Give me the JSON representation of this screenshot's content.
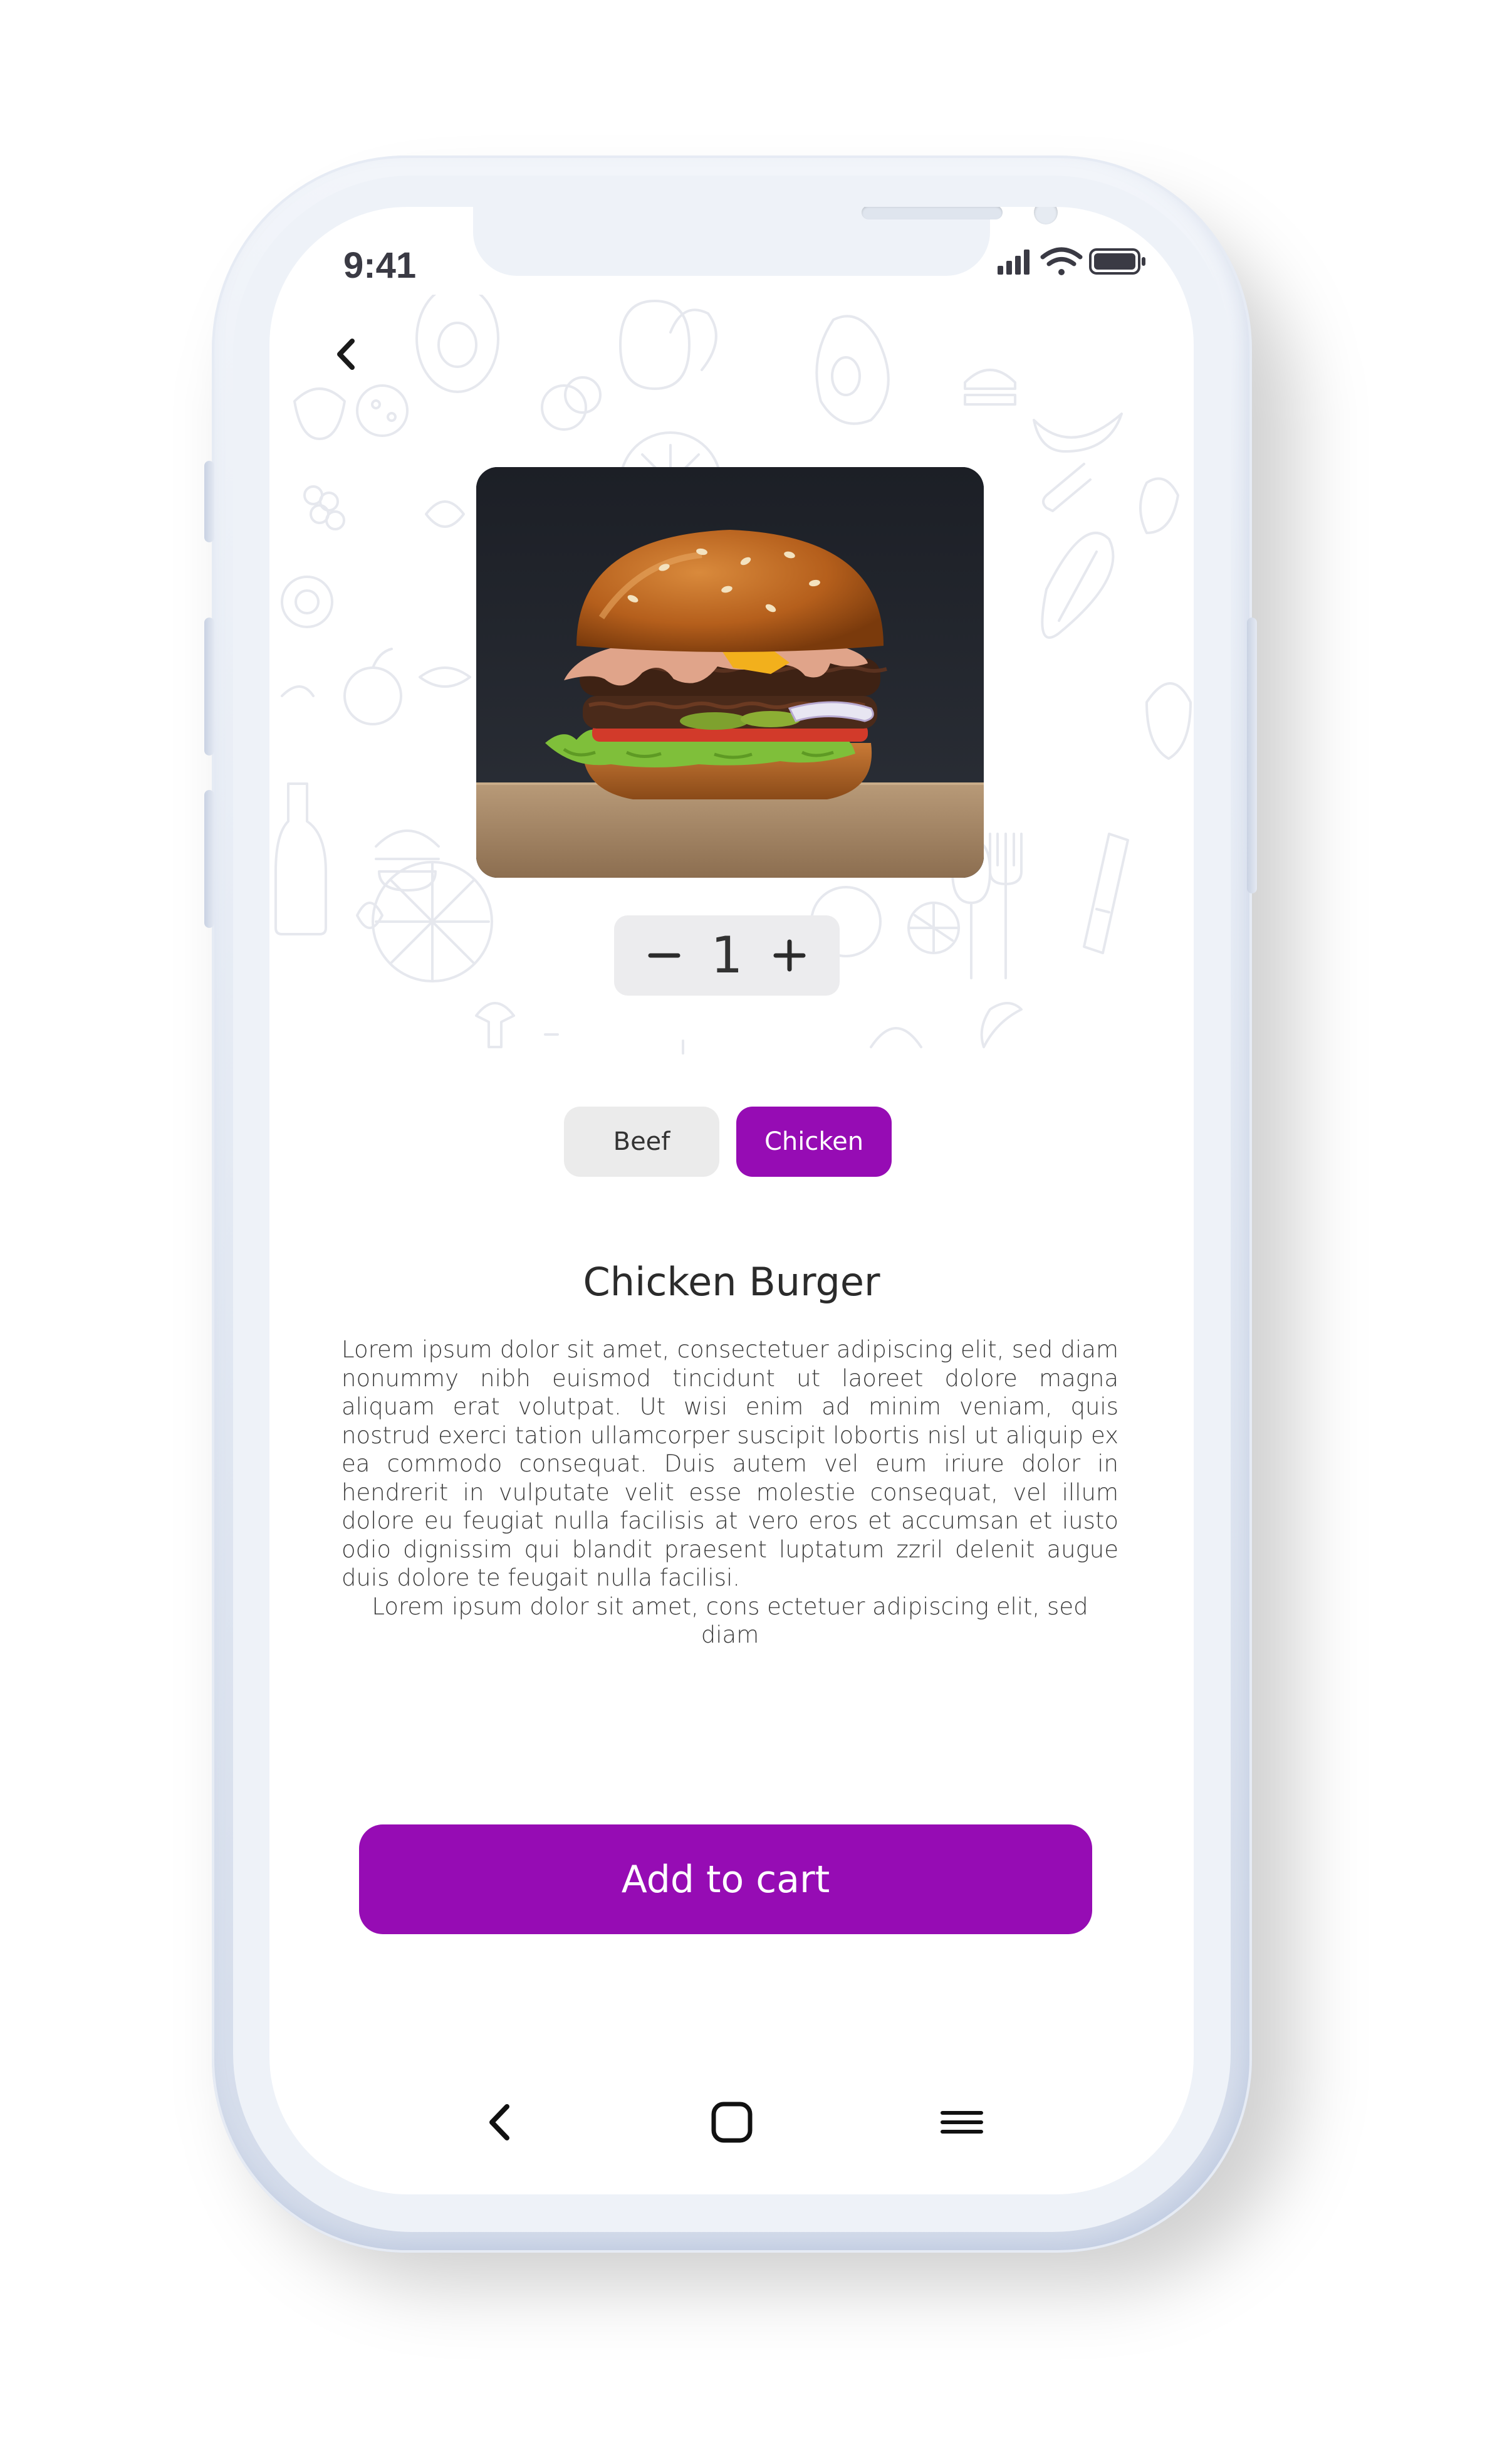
{
  "status_bar": {
    "time": "9:41",
    "icons": [
      "signal-icon",
      "wifi-icon",
      "battery-icon"
    ]
  },
  "header": {
    "back_icon": "chevron-left-icon"
  },
  "product": {
    "image_alt": "burger-photo",
    "title": "Chicken Burger",
    "description": "Lorem ipsum dolor sit amet, consectetuer adipiscing elit, sed diam nonummy nibh euismod tincidunt ut laoreet dolore magna aliquam erat volutpat. Ut wisi enim ad minim veniam, quis nostrud exerci tation ullamcorper suscipit lobortis nisl ut aliquip ex ea commodo consequat. Duis autem vel eum iriure dolor in hendrerit in vulputate velit esse molestie consequat, vel illum dolore eu feugiat nulla facilisis at vero eros et accumsan et iusto odio dignissim qui blandit praesent luptatum zzril delenit augue duis dolore te feugait nulla facilisi.",
    "description_line2": "Lorem ipsum dolor sit amet, cons ectetuer adipiscing elit, sed diam"
  },
  "quantity": {
    "value": "1",
    "decrement_icon": "minus-icon",
    "increment_icon": "plus-icon"
  },
  "options": [
    {
      "label": "Beef",
      "selected": false
    },
    {
      "label": "Chicken",
      "selected": true
    }
  ],
  "cta": {
    "label": "Add to cart"
  },
  "nav": {
    "items": [
      "back-nav-icon",
      "home-nav-icon",
      "menu-nav-icon"
    ]
  },
  "colors": {
    "accent": "#960cb4",
    "chip_inactive": "#ebebeb",
    "stepper_bg": "#ececee",
    "text": "#2b2b2b"
  }
}
